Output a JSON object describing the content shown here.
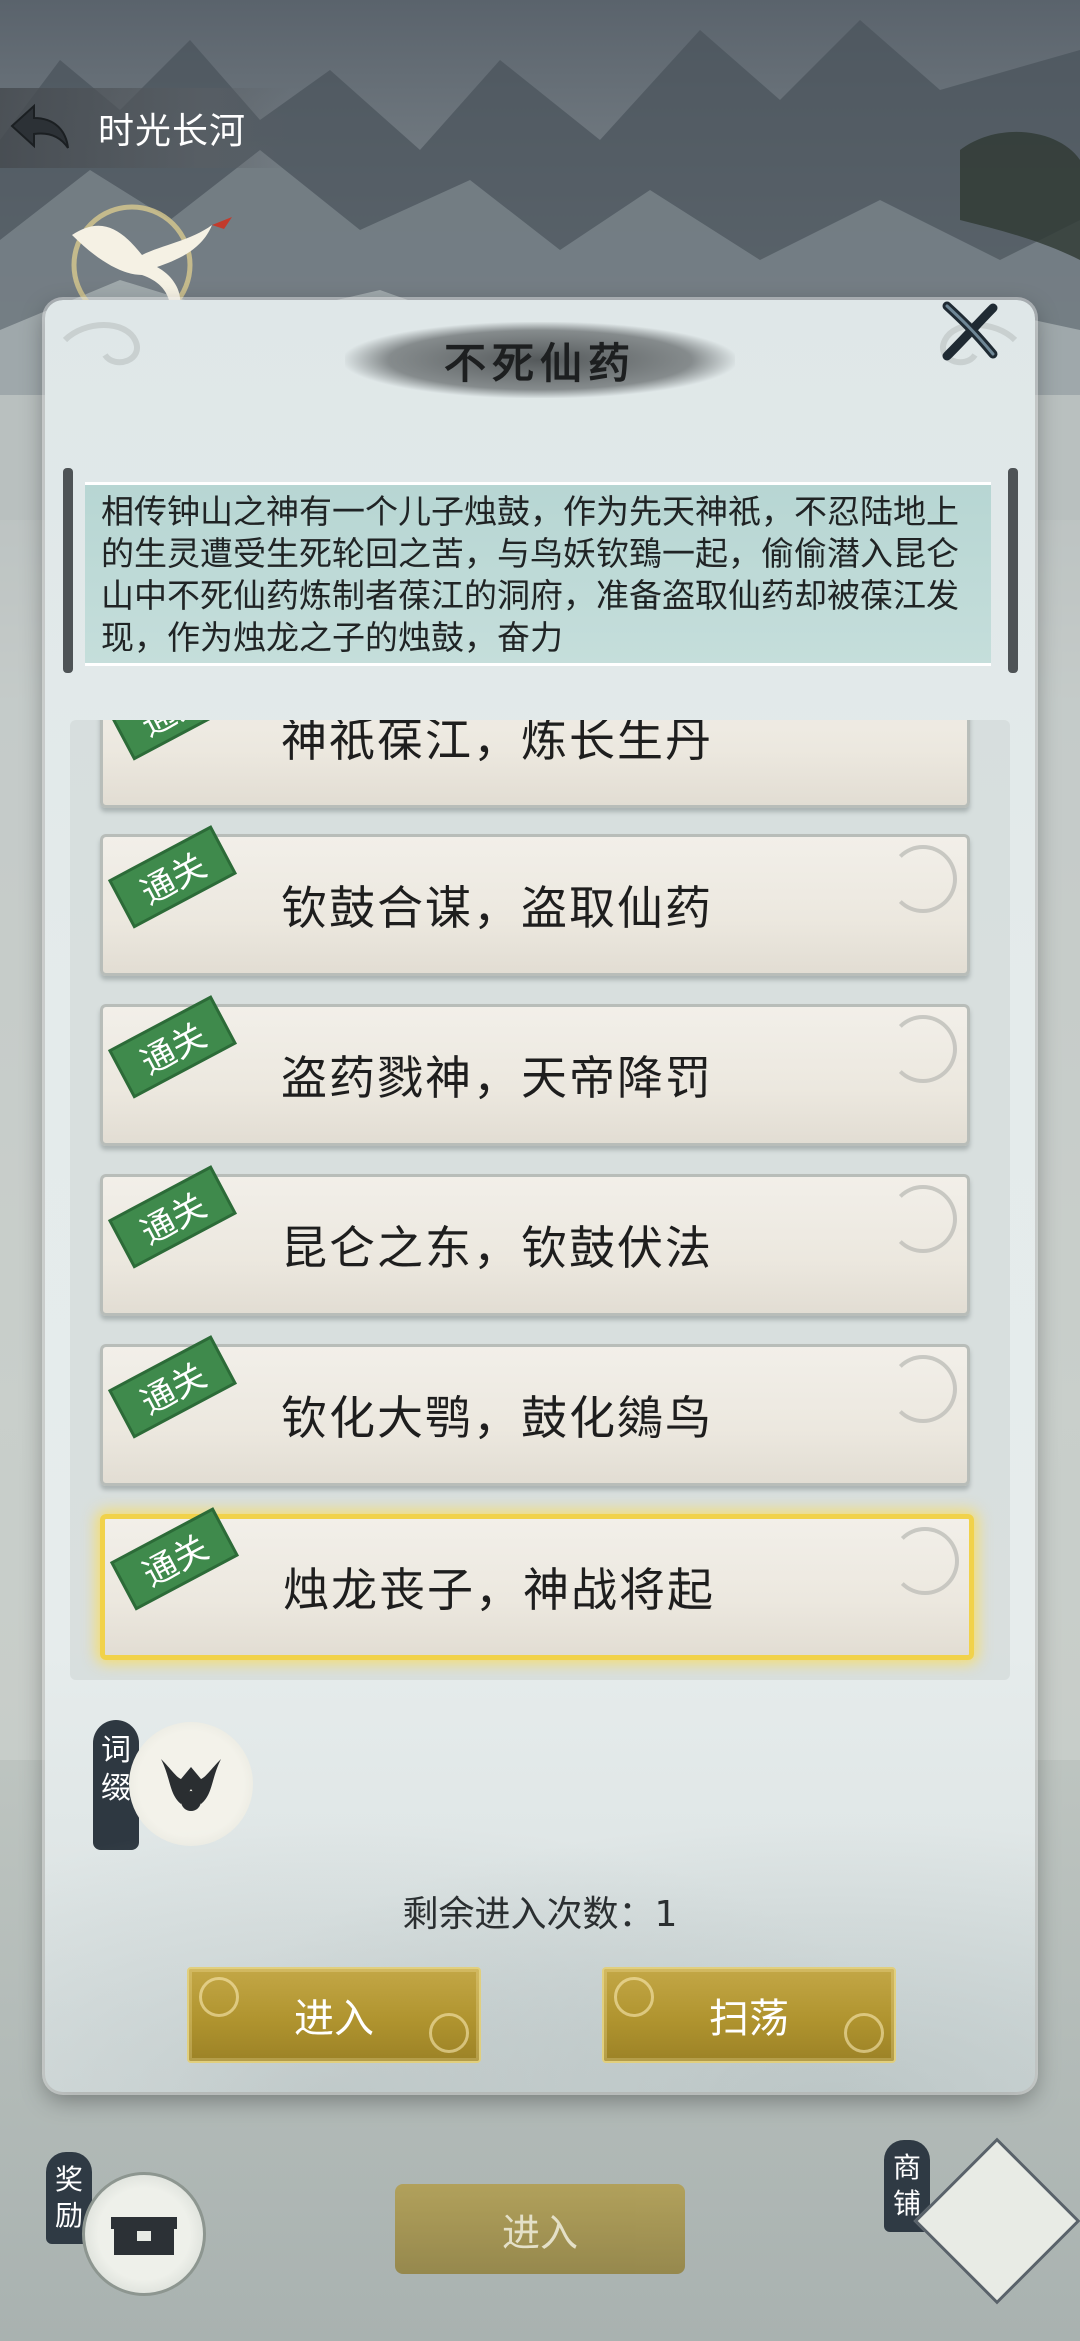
{
  "header": {
    "back_title": "时光长河"
  },
  "modal": {
    "title": "不死仙药",
    "description": "相传钟山之神有一个儿子烛鼓，作为先天神祇，不忍陆地上的生灵遭受生死轮回之苦，与鸟妖钦鵄一起，偷偷潜入昆仑山中不死仙药炼制者葆江的洞府，准备盗取仙药却被葆江发现，作为烛龙之子的烛鼓，奋力",
    "badge_text": "通关",
    "levels": [
      {
        "name": "神祇葆江，炼长生丹",
        "status": "通关"
      },
      {
        "name": "钦鼓合谋，盗取仙药",
        "status": "通关"
      },
      {
        "name": "盗药戮神，天帝降罚",
        "status": "通关"
      },
      {
        "name": "昆仑之东，钦鼓伏法",
        "status": "通关"
      },
      {
        "name": "钦化大鹗，鼓化鵕鸟",
        "status": "通关"
      },
      {
        "name": "烛龙丧子，神战将起",
        "status": "通关"
      }
    ],
    "affix_label": "词缀",
    "remaining_text": "剩余进入次数：1",
    "enter_label": "进入",
    "sweep_label": "扫荡"
  },
  "background": {
    "enter_label": "进入",
    "reward_label": "奖励",
    "shop_label": "商铺"
  },
  "colors": {
    "gold_button": "#b0942f",
    "selected_border": "#f1d24a",
    "badge_green": "#3f8a4c",
    "scroll_paper": "#b7d6d3"
  }
}
